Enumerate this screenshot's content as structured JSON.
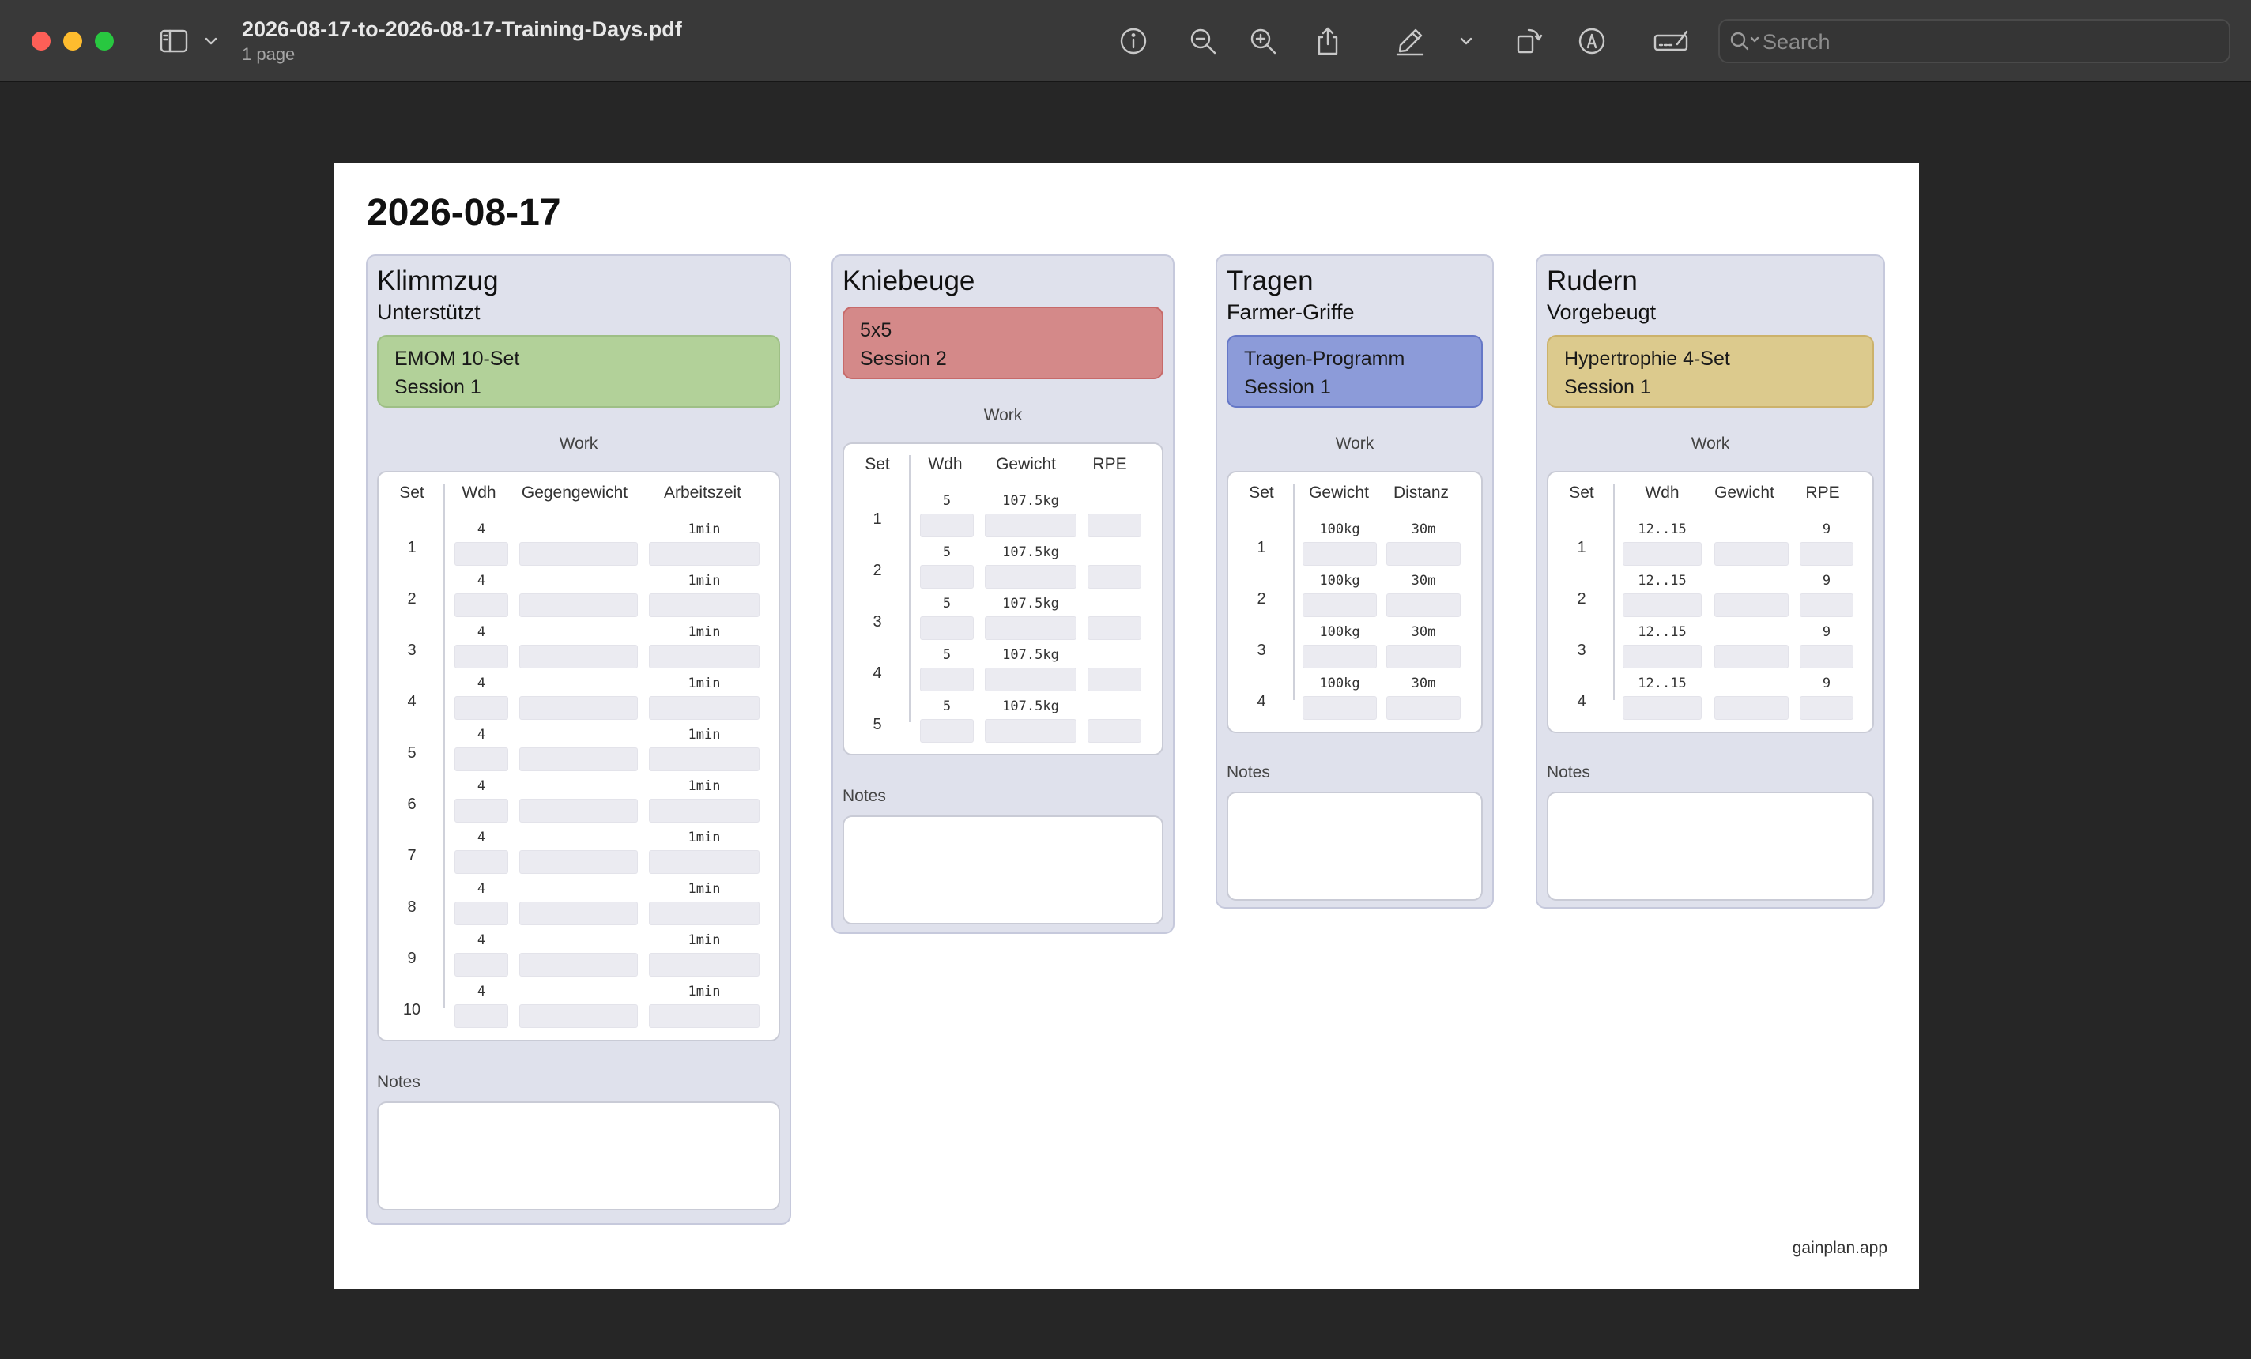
{
  "window": {
    "title": "2026-08-17-to-2026-08-17-Training-Days.pdf",
    "subtitle": "1 page",
    "search_placeholder": "Search",
    "toolbar_icons": [
      "sidebar-icon",
      "chevron-down-icon",
      "info-icon",
      "zoom-out-icon",
      "zoom-in-icon",
      "share-icon",
      "highlighter-icon",
      "chevron-down-icon",
      "rotate-icon",
      "markup-icon",
      "signature-icon",
      "search-icon"
    ]
  },
  "page": {
    "date": "2026-08-17",
    "footer": "gainplan.app",
    "exercises": [
      {
        "name": "Klimmzug",
        "variant": "Unterstützt",
        "color": "#b2d199",
        "program": "EMOM 10-Set",
        "session": "Session 1",
        "work_label": "Work",
        "notes_label": "Notes",
        "columns": [
          "Set",
          "Wdh",
          "Gegengewicht",
          "Arbeitszeit"
        ],
        "sets": [
          {
            "set": "1",
            "values": [
              "4",
              "",
              "1min"
            ]
          },
          {
            "set": "2",
            "values": [
              "4",
              "",
              "1min"
            ]
          },
          {
            "set": "3",
            "values": [
              "4",
              "",
              "1min"
            ]
          },
          {
            "set": "4",
            "values": [
              "4",
              "",
              "1min"
            ]
          },
          {
            "set": "5",
            "values": [
              "4",
              "",
              "1min"
            ]
          },
          {
            "set": "6",
            "values": [
              "4",
              "",
              "1min"
            ]
          },
          {
            "set": "7",
            "values": [
              "4",
              "",
              "1min"
            ]
          },
          {
            "set": "8",
            "values": [
              "4",
              "",
              "1min"
            ]
          },
          {
            "set": "9",
            "values": [
              "4",
              "",
              "1min"
            ]
          },
          {
            "set": "10",
            "values": [
              "4",
              "",
              "1min"
            ]
          }
        ]
      },
      {
        "name": "Kniebeuge",
        "variant": "",
        "color": "#d48989",
        "program": "5x5",
        "session": "Session 2",
        "work_label": "Work",
        "notes_label": "Notes",
        "columns": [
          "Set",
          "Wdh",
          "Gewicht",
          "RPE"
        ],
        "sets": [
          {
            "set": "1",
            "values": [
              "5",
              "107.5kg",
              ""
            ]
          },
          {
            "set": "2",
            "values": [
              "5",
              "107.5kg",
              ""
            ]
          },
          {
            "set": "3",
            "values": [
              "5",
              "107.5kg",
              ""
            ]
          },
          {
            "set": "4",
            "values": [
              "5",
              "107.5kg",
              ""
            ]
          },
          {
            "set": "5",
            "values": [
              "5",
              "107.5kg",
              ""
            ]
          }
        ]
      },
      {
        "name": "Tragen",
        "variant": "Farmer-Griffe",
        "color": "#8c9bd9",
        "program": "Tragen-Programm",
        "session": "Session 1",
        "work_label": "Work",
        "notes_label": "Notes",
        "columns": [
          "Set",
          "Gewicht",
          "Distanz"
        ],
        "sets": [
          {
            "set": "1",
            "values": [
              "100kg",
              "30m"
            ]
          },
          {
            "set": "2",
            "values": [
              "100kg",
              "30m"
            ]
          },
          {
            "set": "3",
            "values": [
              "100kg",
              "30m"
            ]
          },
          {
            "set": "4",
            "values": [
              "100kg",
              "30m"
            ]
          }
        ]
      },
      {
        "name": "Rudern",
        "variant": "Vorgebeugt",
        "color": "#dcca8d",
        "program": "Hypertrophie 4-Set",
        "session": "Session 1",
        "work_label": "Work",
        "notes_label": "Notes",
        "columns": [
          "Set",
          "Wdh",
          "Gewicht",
          "RPE"
        ],
        "sets": [
          {
            "set": "1",
            "values": [
              "12..15",
              "",
              "9"
            ]
          },
          {
            "set": "2",
            "values": [
              "12..15",
              "",
              "9"
            ]
          },
          {
            "set": "3",
            "values": [
              "12..15",
              "",
              "9"
            ]
          },
          {
            "set": "4",
            "values": [
              "12..15",
              "",
              "9"
            ]
          }
        ]
      }
    ]
  }
}
